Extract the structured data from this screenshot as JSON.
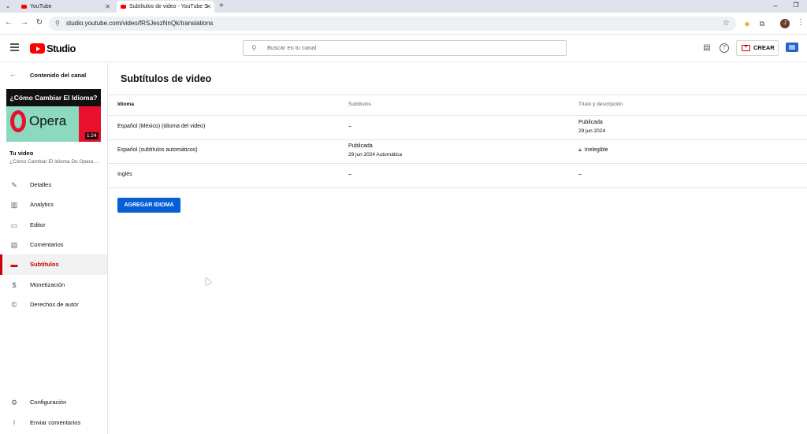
{
  "browser": {
    "tabs": [
      {
        "title": "YouTube"
      },
      {
        "title": "Subtítulos de video - YouTube S"
      }
    ],
    "url": "studio.youtube.com/video/fRSJeszNnQk/translations",
    "profile_initial": "J"
  },
  "header": {
    "brand": "Studio",
    "search_placeholder": "Buscar en tu canal",
    "create_label": "CREAR"
  },
  "sidebar": {
    "back_label": "Contenido del canal",
    "thumbnail": {
      "title_text": "¿Cómo Cambiar El Idioma?",
      "logo_text": "Opera",
      "duration": "1:24"
    },
    "section_label": "Tu video",
    "video_title": "¿Cómo Cambiar El Idioma De Opera ...",
    "items": [
      {
        "label": "Detalles",
        "icon": "pencil-icon"
      },
      {
        "label": "Analytics",
        "icon": "chart-icon"
      },
      {
        "label": "Editor",
        "icon": "film-icon"
      },
      {
        "label": "Comentarios",
        "icon": "comment-icon"
      },
      {
        "label": "Subtítulos",
        "icon": "subtitles-icon",
        "active": true
      },
      {
        "label": "Monetización",
        "icon": "dollar-icon"
      },
      {
        "label": "Derechos de autor",
        "icon": "copyright-icon"
      }
    ],
    "bottom_items": [
      {
        "label": "Configuración",
        "icon": "gear-icon"
      },
      {
        "label": "Enviar comentarios",
        "icon": "feedback-icon"
      }
    ]
  },
  "main": {
    "title": "Subtítulos de video",
    "columns": [
      "Idioma",
      "Subtítulos",
      "Título y descripción"
    ],
    "rows": [
      {
        "language": "Español (México) (idioma del video)",
        "subtitles": "–",
        "subtitles_sub": "",
        "title_desc": "Publicada",
        "title_desc_sub": "29 jun 2024"
      },
      {
        "language": "Español (subtítulos automáticos)",
        "subtitles": "Publicada",
        "subtitles_sub": "29 jun 2024 Automática",
        "title_desc": "Inelegible",
        "title_desc_sub": ""
      },
      {
        "language": "Inglés",
        "subtitles": "–",
        "subtitles_sub": "",
        "title_desc": "–",
        "title_desc_sub": ""
      }
    ],
    "add_language_label": "AGREGAR IDIOMA"
  },
  "colors": {
    "accent_red": "#cc0000",
    "primary_blue": "#065fd4"
  }
}
